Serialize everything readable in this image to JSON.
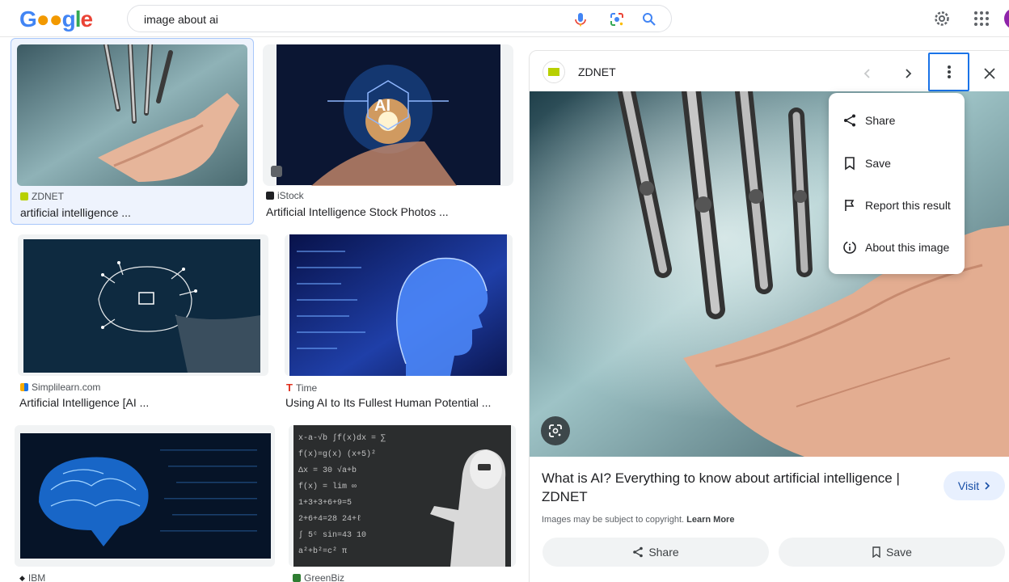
{
  "header": {
    "logo": "Google",
    "search_query": "image about ai",
    "icons": [
      "mic-icon",
      "lens-icon",
      "search-icon",
      "settings-icon",
      "apps-icon",
      "avatar"
    ]
  },
  "results": [
    {
      "source": "ZDNET",
      "title": "artificial intelligence ..."
    },
    {
      "source": "iStock",
      "title": "Artificial Intelligence Stock Photos ..."
    },
    {
      "source": "Simplilearn.com",
      "title": "Artificial Intelligence [AI ..."
    },
    {
      "source": "Time",
      "title": "Using AI to Its Fullest Human Potential ..."
    },
    {
      "source": "IBM",
      "title": ""
    },
    {
      "source": "GreenBiz",
      "title": ""
    }
  ],
  "panel": {
    "source": "ZDNET",
    "logo_text": "ZD NET",
    "title": "What is AI? Everything to know about artificial intelligence | ZDNET",
    "visit_label": "Visit",
    "copyright": "Images may be subject to copyright.",
    "learn_more": "Learn More",
    "share_label": "Share",
    "save_label": "Save"
  },
  "menu": {
    "items": [
      "Share",
      "Save",
      "Report this result",
      "About this image"
    ]
  },
  "colors": {
    "accent": "#1a73e8",
    "visit_bg": "#e8f0fe",
    "selected_bg": "#eef3fd"
  }
}
